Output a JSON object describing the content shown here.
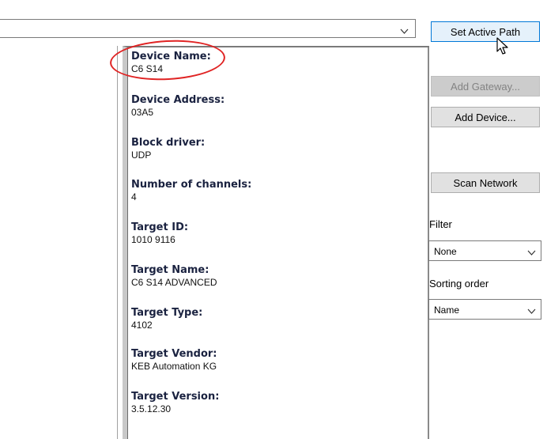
{
  "path_combo": {
    "value": "",
    "chevron_icon": "chevron-down-icon"
  },
  "device_info": {
    "fields": [
      {
        "label": "Device Name:",
        "value": "C6 S14"
      },
      {
        "label": "Device Address:",
        "value": "03A5"
      },
      {
        "label": "Block driver:",
        "value": "UDP"
      },
      {
        "label": "Number of channels:",
        "value": "4"
      },
      {
        "label": "Target ID:",
        "value": "1010 9116"
      },
      {
        "label": "Target Name:",
        "value": "C6 S14 ADVANCED"
      },
      {
        "label": "Target Type:",
        "value": "4102"
      },
      {
        "label": "Target Vendor:",
        "value": "KEB Automation KG"
      },
      {
        "label": "Target Version:",
        "value": "3.5.12.30"
      }
    ]
  },
  "sidebar": {
    "set_active_path": "Set Active Path",
    "add_gateway": "Add Gateway...",
    "add_device": "Add Device...",
    "scan_network": "Scan Network",
    "filter_label": "Filter",
    "filter_value": "None",
    "sorting_label": "Sorting order",
    "sorting_value": "Name"
  },
  "colors": {
    "highlight": "#e02424",
    "active_border": "#0078d7"
  }
}
